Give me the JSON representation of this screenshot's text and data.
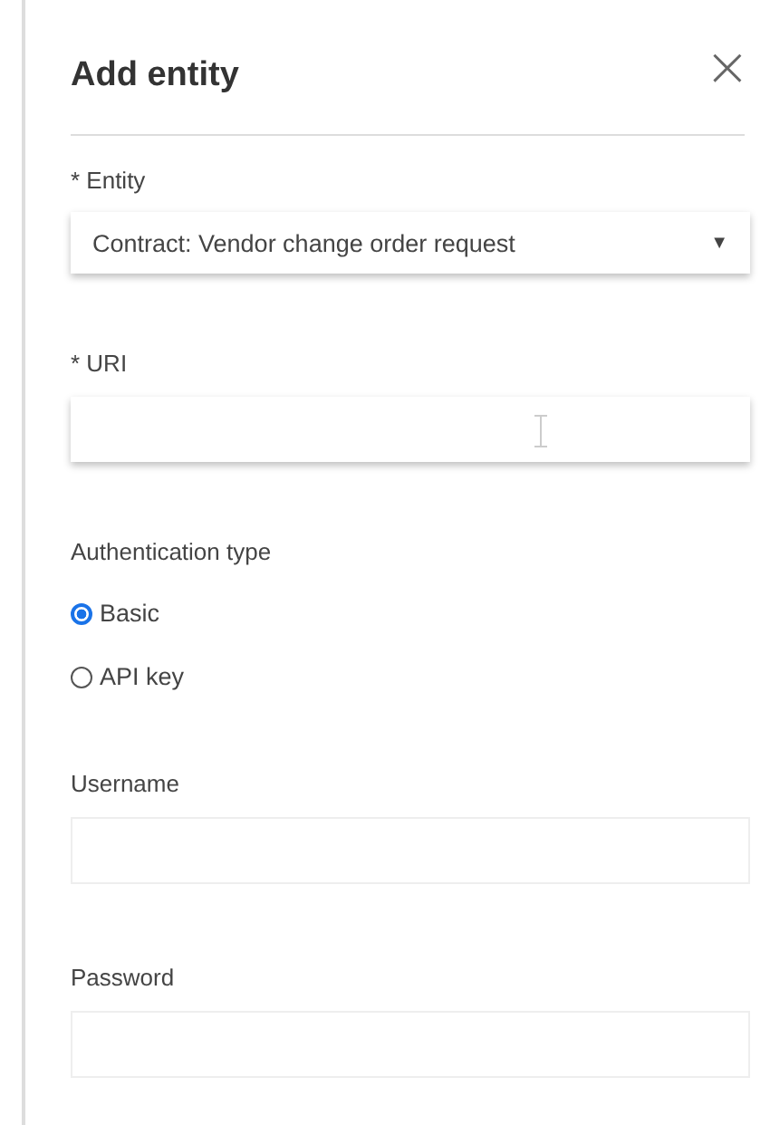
{
  "panel": {
    "title": "Add entity",
    "close": "×"
  },
  "entity": {
    "label": "* Entity",
    "value": "Contract: Vendor change order request",
    "caret": "▼"
  },
  "uri": {
    "label": "* URI"
  },
  "authentication": {
    "label": "Authentication type",
    "options": [
      {
        "label": "Basic",
        "selected": true
      },
      {
        "label": "API key",
        "selected": false
      }
    ]
  },
  "credentials": [
    {
      "label": "Username"
    },
    {
      "label": "Password"
    }
  ]
}
